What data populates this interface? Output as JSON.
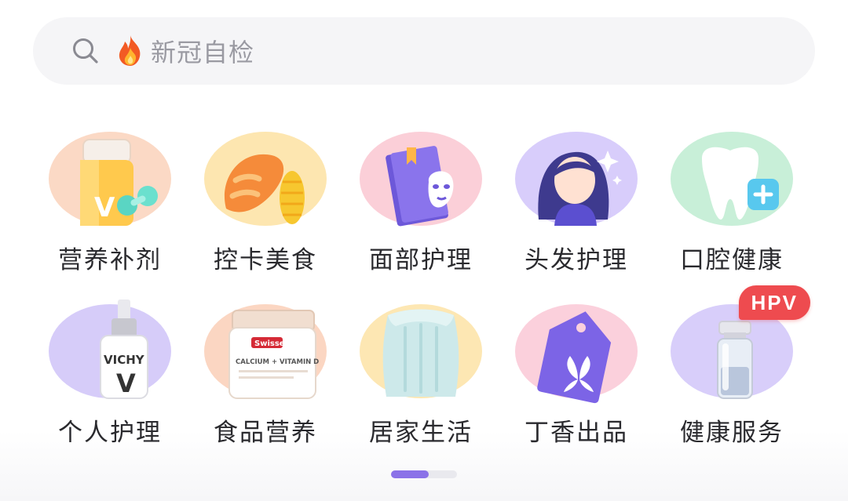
{
  "search": {
    "placeholder": "新冠自检",
    "search_icon": "search-icon",
    "badge_icon": "fire-icon"
  },
  "categories": [
    {
      "label": "营养补剂",
      "icon": "vitamin-bottle-icon",
      "bg": "#fbd9c5"
    },
    {
      "label": "控卡美食",
      "icon": "bread-icon",
      "bg": "#fde6b0"
    },
    {
      "label": "面部护理",
      "icon": "face-mask-book-icon",
      "bg": "#fbcfd8"
    },
    {
      "label": "头发护理",
      "icon": "woman-hair-icon",
      "bg": "#d8cdfb"
    },
    {
      "label": "口腔健康",
      "icon": "tooth-icon",
      "bg": "#c8efd8"
    },
    {
      "label": "个人护理",
      "icon": "serum-bottle-icon",
      "bg": "#d6ccf9"
    },
    {
      "label": "食品营养",
      "icon": "supplement-jar-icon",
      "bg": "#fbd6c2"
    },
    {
      "label": "居家生活",
      "icon": "pillow-icon",
      "bg": "#fde7b3"
    },
    {
      "label": "丁香出品",
      "icon": "clove-tag-icon",
      "bg": "#fbd0dc"
    },
    {
      "label": "健康服务",
      "icon": "vaccine-vial-icon",
      "bg": "#d8cefa",
      "badge": "HPV"
    }
  ],
  "icon_text": {
    "vichy": "VICHY",
    "vichy_v": "V",
    "swisse": "Swisse",
    "calcium": "CALCIUM + VITAMIN D",
    "vitamin_v": "V"
  },
  "pager": {
    "pages": 2,
    "current": 1
  },
  "colors": {
    "accent": "#8b72e8",
    "badge": "#ee4b4f"
  }
}
